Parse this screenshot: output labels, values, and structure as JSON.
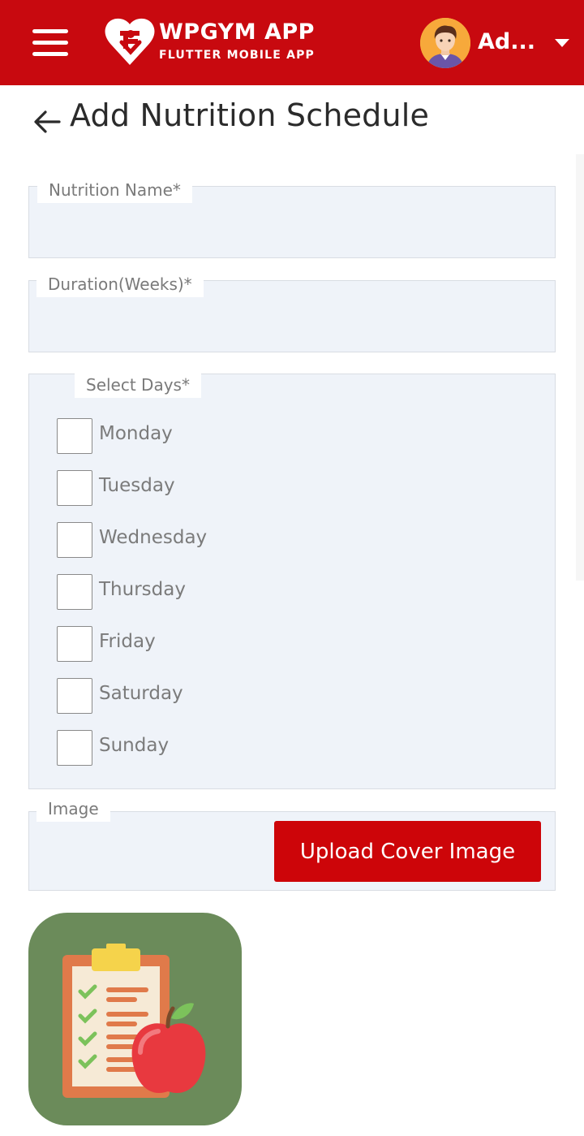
{
  "header": {
    "brand_title": "WPGYM APP",
    "brand_subtitle": "FLUTTER MOBILE APP",
    "user_name": "Ad...",
    "accent_color": "#c8090f"
  },
  "page": {
    "title": "Add Nutrition Schedule"
  },
  "form": {
    "nutrition_name": {
      "label": "Nutrition Name*",
      "value": ""
    },
    "duration": {
      "label": "Duration(Weeks)*",
      "value": ""
    },
    "select_days": {
      "label": "Select Days*",
      "days": [
        {
          "label": "Monday",
          "checked": false
        },
        {
          "label": "Tuesday",
          "checked": false
        },
        {
          "label": "Wednesday",
          "checked": false
        },
        {
          "label": "Thursday",
          "checked": false
        },
        {
          "label": "Friday",
          "checked": false
        },
        {
          "label": "Saturday",
          "checked": false
        },
        {
          "label": "Sunday",
          "checked": false
        }
      ]
    },
    "image": {
      "label": "Image",
      "upload_label": "Upload Cover Image"
    }
  },
  "icons": {
    "menu": "menu-icon",
    "logo": "wpgym-logo",
    "avatar": "user-avatar",
    "dropdown": "chevron-down-icon",
    "back": "arrow-left-icon",
    "cover": "clipboard-apple-icon"
  }
}
